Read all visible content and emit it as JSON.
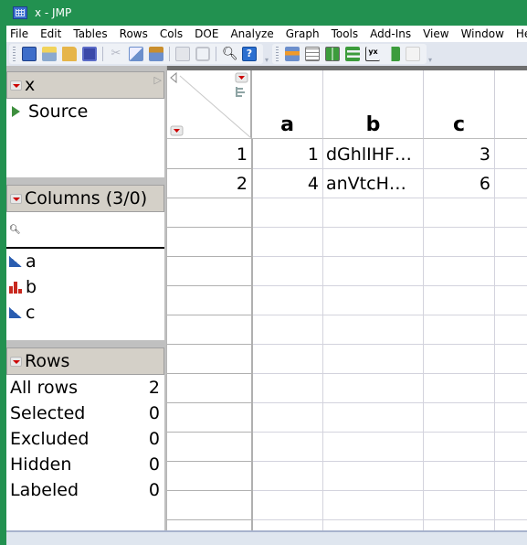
{
  "window": {
    "title": "x - JMP"
  },
  "menu": [
    "File",
    "Edit",
    "Tables",
    "Rows",
    "Cols",
    "DOE",
    "Analyze",
    "Graph",
    "Tools",
    "Add-Ins",
    "View",
    "Window",
    "Help"
  ],
  "toolbar": {
    "group1": [
      "new-data-table-icon",
      "new-script-icon",
      "open-folder-icon",
      "save-icon",
      "cut-icon",
      "copy-icon",
      "paste-icon",
      "journal-icon",
      "lock-icon",
      "search-icon",
      "help-icon"
    ],
    "group2": [
      "data-table-icon",
      "column-info-icon",
      "distribution-icon",
      "bar-chart-icon",
      "fit-y-by-x-icon",
      "fit-model-icon",
      "edit-icon"
    ]
  },
  "table_panel": {
    "title": "x",
    "items": [
      {
        "label": "Source",
        "icon": "green-triangle"
      }
    ]
  },
  "columns_panel": {
    "title": "Columns (3/0)",
    "search_placeholder": "",
    "columns": [
      {
        "name": "a",
        "type": "continuous"
      },
      {
        "name": "b",
        "type": "nominal"
      },
      {
        "name": "c",
        "type": "continuous"
      }
    ]
  },
  "rows_panel": {
    "title": "Rows",
    "items": [
      {
        "label": "All rows",
        "value": "2"
      },
      {
        "label": "Selected",
        "value": "0"
      },
      {
        "label": "Excluded",
        "value": "0"
      },
      {
        "label": "Hidden",
        "value": "0"
      },
      {
        "label": "Labeled",
        "value": "0"
      }
    ]
  },
  "grid": {
    "headers": [
      "a",
      "b",
      "c"
    ],
    "rows": [
      {
        "num": "1",
        "a": "1",
        "b": "dGhlIHF…",
        "c": "3"
      },
      {
        "num": "2",
        "a": "4",
        "b": "anVtcH…",
        "c": "6"
      }
    ]
  },
  "colors": {
    "title_bar": "#229150",
    "accent_red": "#cc0000",
    "continuous_icon": "#2a5db0",
    "nominal_icon": "#c8281e"
  }
}
